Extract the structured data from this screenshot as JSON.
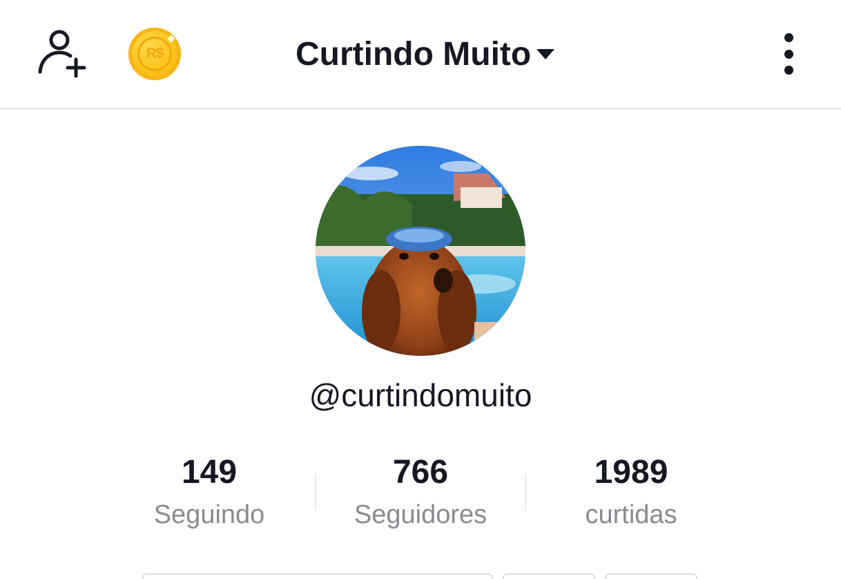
{
  "header": {
    "account_name": "Curtindo Muito",
    "coin_label": "R$",
    "icons": {
      "add_user": "add-user-icon",
      "coin": "coin-icon",
      "dropdown": "caret-down-icon",
      "more": "more-vertical-icon"
    }
  },
  "profile": {
    "username": "@curtindomuito",
    "avatar": "avatar-photo"
  },
  "stats": [
    {
      "value": "149",
      "label": "Seguindo"
    },
    {
      "value": "766",
      "label": "Seguidores"
    },
    {
      "value": "1989",
      "label": "curtidas"
    }
  ],
  "colors": {
    "text_primary": "#161823",
    "text_secondary": "#8a8b91",
    "coin_gold": "#fcc21b",
    "divider": "#e3e3e4"
  }
}
